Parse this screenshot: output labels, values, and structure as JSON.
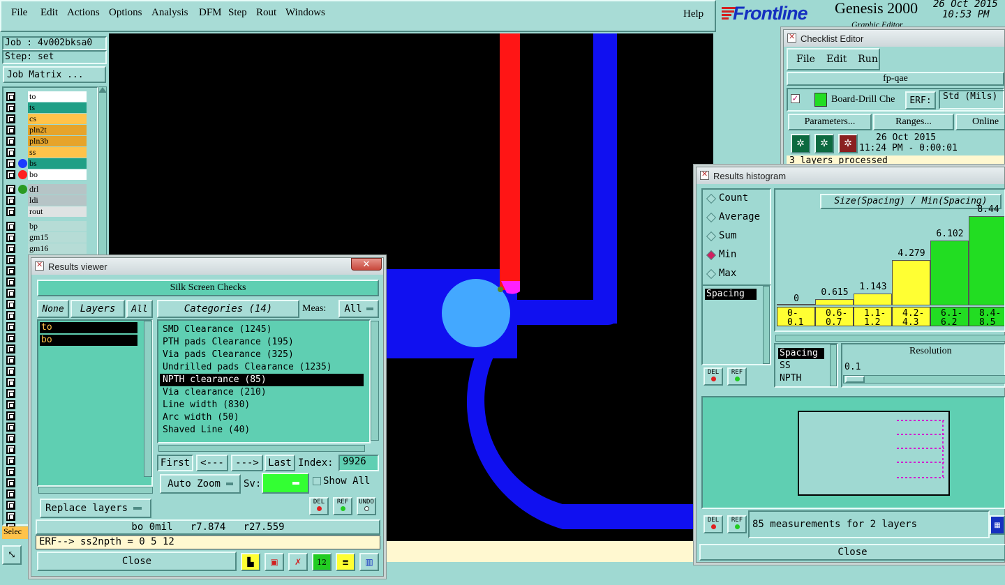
{
  "menubar": {
    "items": [
      "File",
      "Edit",
      "Actions",
      "Options",
      "Analysis",
      "DFM",
      "Step",
      "Rout",
      "Windows"
    ],
    "help": "Help"
  },
  "brand": {
    "logo": "Frontline",
    "product": "Genesis 2000",
    "subtitle": "Graphic Editor",
    "date": "26 Oct 2015",
    "time": "10:53 PM"
  },
  "left_panel": {
    "job": "Job : 4v002bksa0",
    "step": "Step: set",
    "job_matrix": "Job Matrix ...",
    "select_label": "Selec",
    "layers": [
      {
        "name": "to",
        "color": "#ffffff",
        "dot": ""
      },
      {
        "name": "ts",
        "color": "#1f9f86",
        "dot": ""
      },
      {
        "name": "cs",
        "color": "#ffc34a",
        "dot": ""
      },
      {
        "name": "pln2t",
        "color": "#e6a42a",
        "dot": ""
      },
      {
        "name": "pln3b",
        "color": "#e6a42a",
        "dot": ""
      },
      {
        "name": "ss",
        "color": "#ffc34a",
        "dot": ""
      },
      {
        "name": "bs",
        "color": "#1f9f86",
        "dot": "#1a3cff"
      },
      {
        "name": "bo",
        "color": "#ffffff",
        "dot": "#ff2020"
      },
      {
        "name": "drl",
        "color": "#b6c4c6",
        "dot": "#2a9a22"
      },
      {
        "name": "ldi",
        "color": "#b6c4c6",
        "dot": ""
      },
      {
        "name": "rout",
        "color": "#dfe3e3",
        "dot": ""
      },
      {
        "name": "bp",
        "color": "#b6dcd6",
        "dot": ""
      },
      {
        "name": "gm15",
        "color": "#b6dcd6",
        "dot": ""
      },
      {
        "name": "gm16",
        "color": "#b6dcd6",
        "dot": ""
      }
    ]
  },
  "results_viewer": {
    "title": "Results viewer",
    "header": "Silk Screen Checks",
    "none": "None",
    "layers_label": "Layers",
    "all": "All",
    "layer_items": [
      "to",
      "bo"
    ],
    "categories_label": "Categories (14)",
    "meas_label": "Meas:",
    "meas_value": "All",
    "categories": [
      "SMD Clearance (1245)",
      "PTH pads Clearance (195)",
      "Via pads Clearance (325)",
      "Undrilled pads Clearance (1235)",
      "NPTH clearance (85)",
      "Via clearance (210)",
      "Line width (830)",
      "Arc width (50)",
      "Shaved Line (40)"
    ],
    "selected_category": "NPTH clearance (85)",
    "first": "First",
    "prev": "<---",
    "next": "--->",
    "last": "Last",
    "index_label": "Index:",
    "index_value": "9926",
    "auto_zoom": "Auto Zoom",
    "sv_label": "Sv:",
    "show_all": "Show All",
    "replace_layers": "Replace layers",
    "del": "DEL",
    "ref": "REF",
    "undo": "UNDO",
    "status_line": "bo 0mil   r7.874   r27.559",
    "erf_line": "ERF--> ss2npth = 0 5 12",
    "close": "Close"
  },
  "checklist_editor": {
    "title": "Checklist Editor",
    "menu": [
      "File",
      "Edit",
      "Run"
    ],
    "name": "fp-qae",
    "check_name": "Board-Drill Che",
    "erf_label": "ERF:",
    "erf_value": "Std (Mils)",
    "parameters": "Parameters...",
    "ranges": "Ranges...",
    "online": "Online",
    "run_date": "26 Oct 2015",
    "run_time": "11:24 PM - 0:00:01",
    "status": "3 layers processed"
  },
  "results_histogram": {
    "title": "Results histogram",
    "modes": [
      "Count",
      "Average",
      "Sum",
      "Min",
      "Max"
    ],
    "selected_mode": "Min",
    "measure_list": [
      "Spacing"
    ],
    "chart_title": "Size(Spacing) / Min(Spacing)",
    "resolution_label": "Resolution",
    "resolution_value": "0.1",
    "attr_list": [
      "Spacing",
      "SS",
      "NPTH"
    ],
    "summary": "85 measurements for 2 layers",
    "del": "DEL",
    "ref": "REF",
    "close": "Close"
  },
  "chart_data": {
    "type": "bar",
    "title": "Size(Spacing) / Min(Spacing)",
    "categories": [
      "0-0.1",
      "0.6-0.7",
      "1.1-1.2",
      "4.2-4.3",
      "6.1-6.2",
      "8.4-8.5"
    ],
    "category_lines": [
      [
        "0-",
        "0.1"
      ],
      [
        "0.6-",
        "0.7"
      ],
      [
        "1.1-",
        "1.2"
      ],
      [
        "4.2-",
        "4.3"
      ],
      [
        "6.1-",
        "6.2"
      ],
      [
        "8.4-",
        "8.5"
      ]
    ],
    "values": [
      0,
      0.615,
      1.143,
      4.279,
      6.102,
      8.44
    ],
    "value_labels": [
      "0",
      "0.615",
      "1.143",
      "4.279",
      "6.102",
      "8.44"
    ],
    "colors": [
      "#ffff33",
      "#ffff33",
      "#ffff33",
      "#ffff33",
      "#22dd22",
      "#22dd22"
    ],
    "ylim": [
      0,
      8.44
    ]
  }
}
